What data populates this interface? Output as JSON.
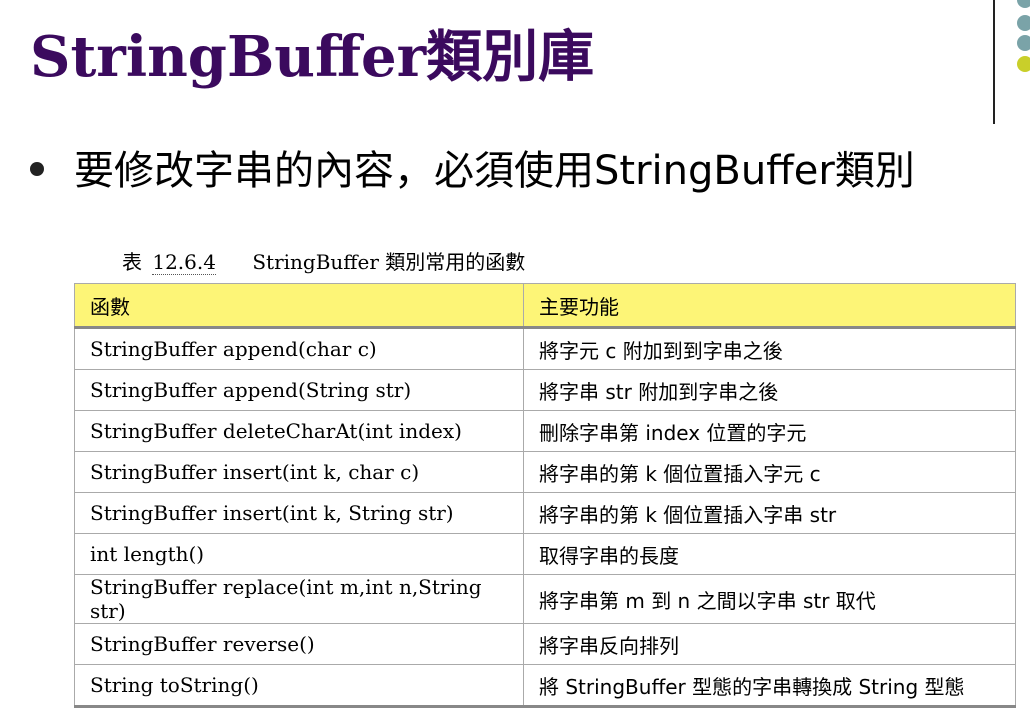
{
  "slide": {
    "title": "StringBuffer類別庫",
    "bullet": "要修改字串的內容，必須使用StringBuffer類別"
  },
  "decoration": {
    "dot_colors": [
      "#7aa3a8",
      "#7aa3a8",
      "#c9cf2a"
    ]
  },
  "table": {
    "caption_prefix": "表",
    "caption_number": "12.6.4",
    "caption_text": "StringBuffer 類別常用的函數",
    "header_bg": "#fdf577",
    "headers": [
      "函數",
      "主要功能"
    ],
    "rows": [
      [
        "StringBuffer append(char c)",
        "將字元 c 附加到到字串之後"
      ],
      [
        "StringBuffer append(String str)",
        "將字串 str 附加到字串之後"
      ],
      [
        "StringBuffer deleteCharAt(int index)",
        "刪除字串第 index 位置的字元"
      ],
      [
        "StringBuffer insert(int k, char c)",
        "將字串的第 k 個位置插入字元 c"
      ],
      [
        "StringBuffer insert(int k, String str)",
        "將字串的第 k 個位置插入字串 str"
      ],
      [
        "int length()",
        "取得字串的長度"
      ],
      [
        "StringBuffer replace(int m,int n,String str)",
        "將字串第 m 到 n 之間以字串 str 取代"
      ],
      [
        "StringBuffer reverse()",
        "將字串反向排列"
      ],
      [
        "String toString()",
        "將 StringBuffer 型態的字串轉換成 String 型態"
      ]
    ]
  }
}
